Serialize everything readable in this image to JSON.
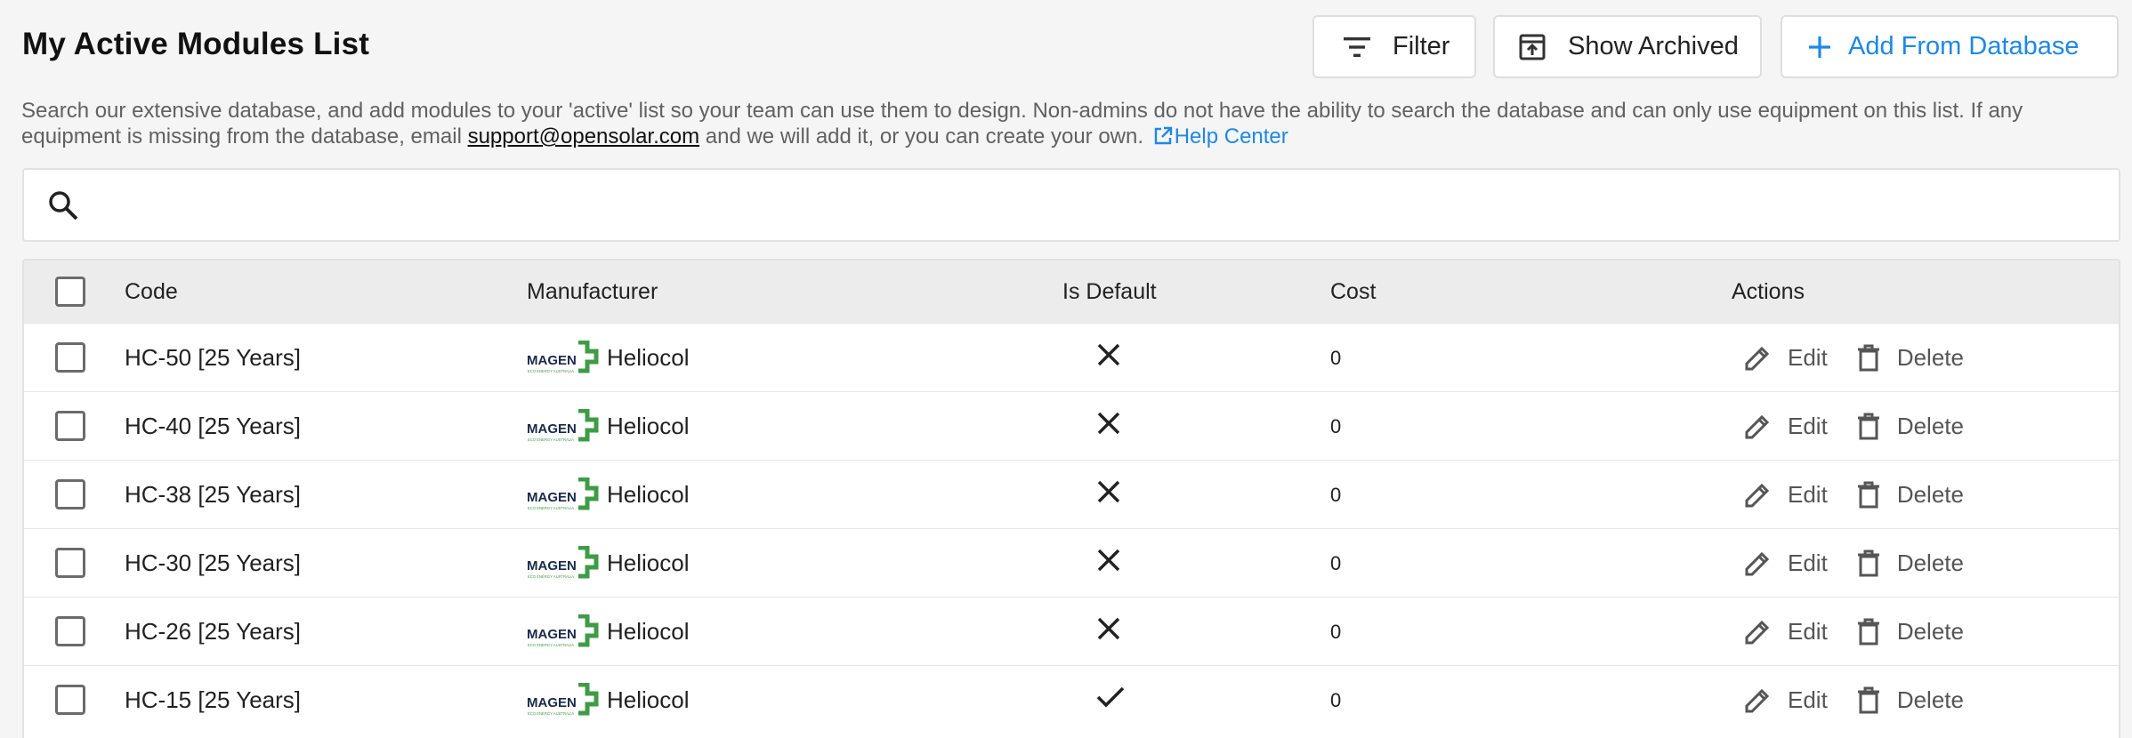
{
  "header": {
    "title": "My Active Modules List",
    "filter_label": "Filter",
    "show_archived_label": "Show Archived",
    "add_from_database_label": "Add From Database"
  },
  "description": {
    "text_before_email": "Search our extensive database, and add modules to your 'active' list so your team can use them to design. Non-admins do not have the ability to search the database and can only use equipment on this list. If any equipment is missing from the database, email",
    "email": "support@opensolar.com",
    "text_after_email": "and we will add it, or you can create your own.",
    "help_link": "Help Center"
  },
  "search": {
    "value": "",
    "placeholder": ""
  },
  "table": {
    "columns": {
      "code": "Code",
      "manufacturer": "Manufacturer",
      "is_default": "Is Default",
      "cost": "Cost",
      "actions": "Actions"
    },
    "edit_label": "Edit",
    "delete_label": "Delete",
    "rows": [
      {
        "code": "HC-50 [25 Years]",
        "manufacturer": "Heliocol",
        "is_default": false,
        "cost": "0"
      },
      {
        "code": "HC-40 [25 Years]",
        "manufacturer": "Heliocol",
        "is_default": false,
        "cost": "0"
      },
      {
        "code": "HC-38 [25 Years]",
        "manufacturer": "Heliocol",
        "is_default": false,
        "cost": "0"
      },
      {
        "code": "HC-30 [25 Years]",
        "manufacturer": "Heliocol",
        "is_default": false,
        "cost": "0"
      },
      {
        "code": "HC-26 [25 Years]",
        "manufacturer": "Heliocol",
        "is_default": false,
        "cost": "0"
      },
      {
        "code": "HC-15 [25 Years]",
        "manufacturer": "Heliocol",
        "is_default": true,
        "cost": "0"
      }
    ]
  },
  "logo": {
    "text": "MAGEN",
    "tagline": "ECO ENERGY AUSTRALIA"
  },
  "icons": {
    "filter": "filter-icon",
    "archive": "archive-icon",
    "add": "plus-icon",
    "search": "search-icon",
    "external_link": "external-link-icon",
    "edit": "pencil-icon",
    "delete": "trash-icon",
    "not_default": "cross-icon",
    "default": "check-icon"
  },
  "colors": {
    "accent": "#1e88e5",
    "logo_green": "#3f9b46",
    "logo_navy": "#1a2a4a",
    "background": "#f5f5f5"
  }
}
